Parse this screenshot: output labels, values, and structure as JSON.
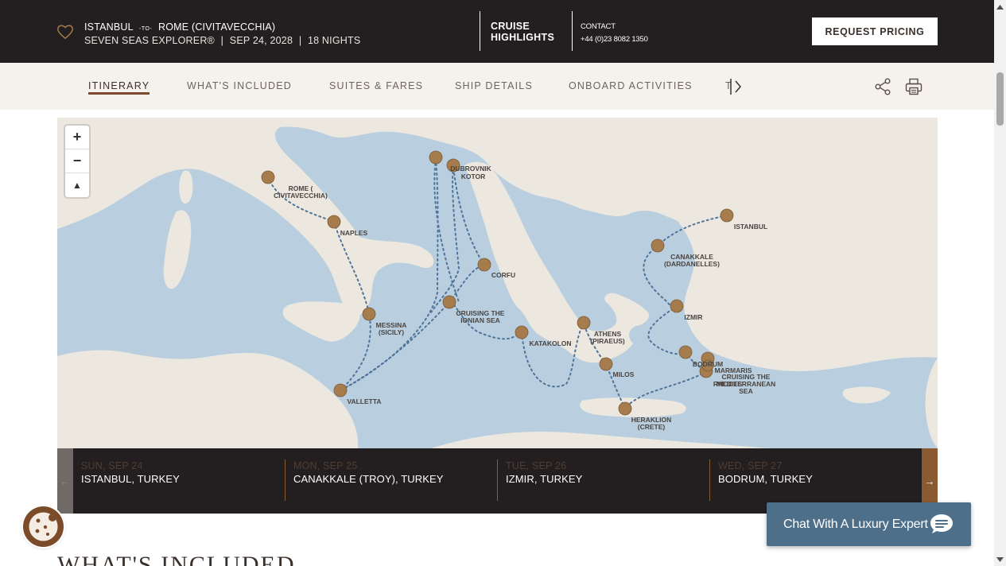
{
  "header": {
    "origin": "ISTANBUL",
    "to": "-TO-",
    "destination": "ROME (CIVITAVECCHIA)",
    "ship": "SEVEN SEAS EXPLORER®",
    "date": "SEP 24, 2028",
    "nights": "18 NIGHTS",
    "sep": "|",
    "highlights_line1": "CRUISE",
    "highlights_line2": "HIGHLIGHTS",
    "contact_label": "CONTACT",
    "contact_phone": "+44 (0)23 8082 1350",
    "request_label": "REQUEST PRICING"
  },
  "tabs": [
    {
      "label": "ITINERARY"
    },
    {
      "label": "WHAT'S INCLUDED"
    },
    {
      "label": "SUITES & FARES"
    },
    {
      "label": "SHIP DETAILS"
    },
    {
      "label": "ONBOARD ACTIVITIES"
    },
    {
      "label": "T"
    }
  ],
  "map": {
    "zoom_in": "+",
    "zoom_out": "−",
    "reset": "▲",
    "ports": [
      {
        "label": "ROME (",
        "label2": "CIVITAVECCHIA)"
      },
      {
        "label": "NAPLES"
      },
      {
        "label": "DUBROVNIK"
      },
      {
        "label": "KOTOR"
      },
      {
        "label": "CORFU"
      },
      {
        "label": "CRUISING THE",
        "label2": "IONIAN SEA"
      },
      {
        "label": "MESSINA",
        "label2": "(SICILY)"
      },
      {
        "label": "VALLETTA"
      },
      {
        "label": "KATAKOLON"
      },
      {
        "label": "ATHENS",
        "label2": "(PIRAEUS)"
      },
      {
        "label": "MILOS"
      },
      {
        "label": "HERAKLION",
        "label2": "(CRETE)"
      },
      {
        "label": "ISTANBUL"
      },
      {
        "label": "CANAKKALE",
        "label2": "(DARDANELLES)"
      },
      {
        "label": "IZMIR"
      },
      {
        "label": "BODRUM"
      },
      {
        "label": "MARMARIS"
      },
      {
        "label": "RHODES"
      },
      {
        "label": "CRUISING THE",
        "label2": "MEDITERRANEAN",
        "label3": "SEA"
      }
    ]
  },
  "itinerary": [
    {
      "date": "SUN, SEP 24",
      "port": "ISTANBUL, TURKEY"
    },
    {
      "date": "MON, SEP 25",
      "port": "CANAKKALE (TROY), TURKEY"
    },
    {
      "date": "TUE, SEP 26",
      "port": "IZMIR, TURKEY"
    },
    {
      "date": "WED, SEP 27",
      "port": "BODRUM, TURKEY"
    }
  ],
  "strip": {
    "prev": "←",
    "next": "→"
  },
  "chat_label": "Chat With A Luxury Expert",
  "section_heading": "WHAT'S INCLUDED",
  "colors": {
    "header_bg": "#231f20",
    "accent": "#8a5a33",
    "subnav_bg": "#f5f2ee",
    "chat_bg": "#4d6f8a",
    "sea": "#b9cfe0",
    "land": "#ece8e0",
    "port_dot": "#a67c4d"
  }
}
